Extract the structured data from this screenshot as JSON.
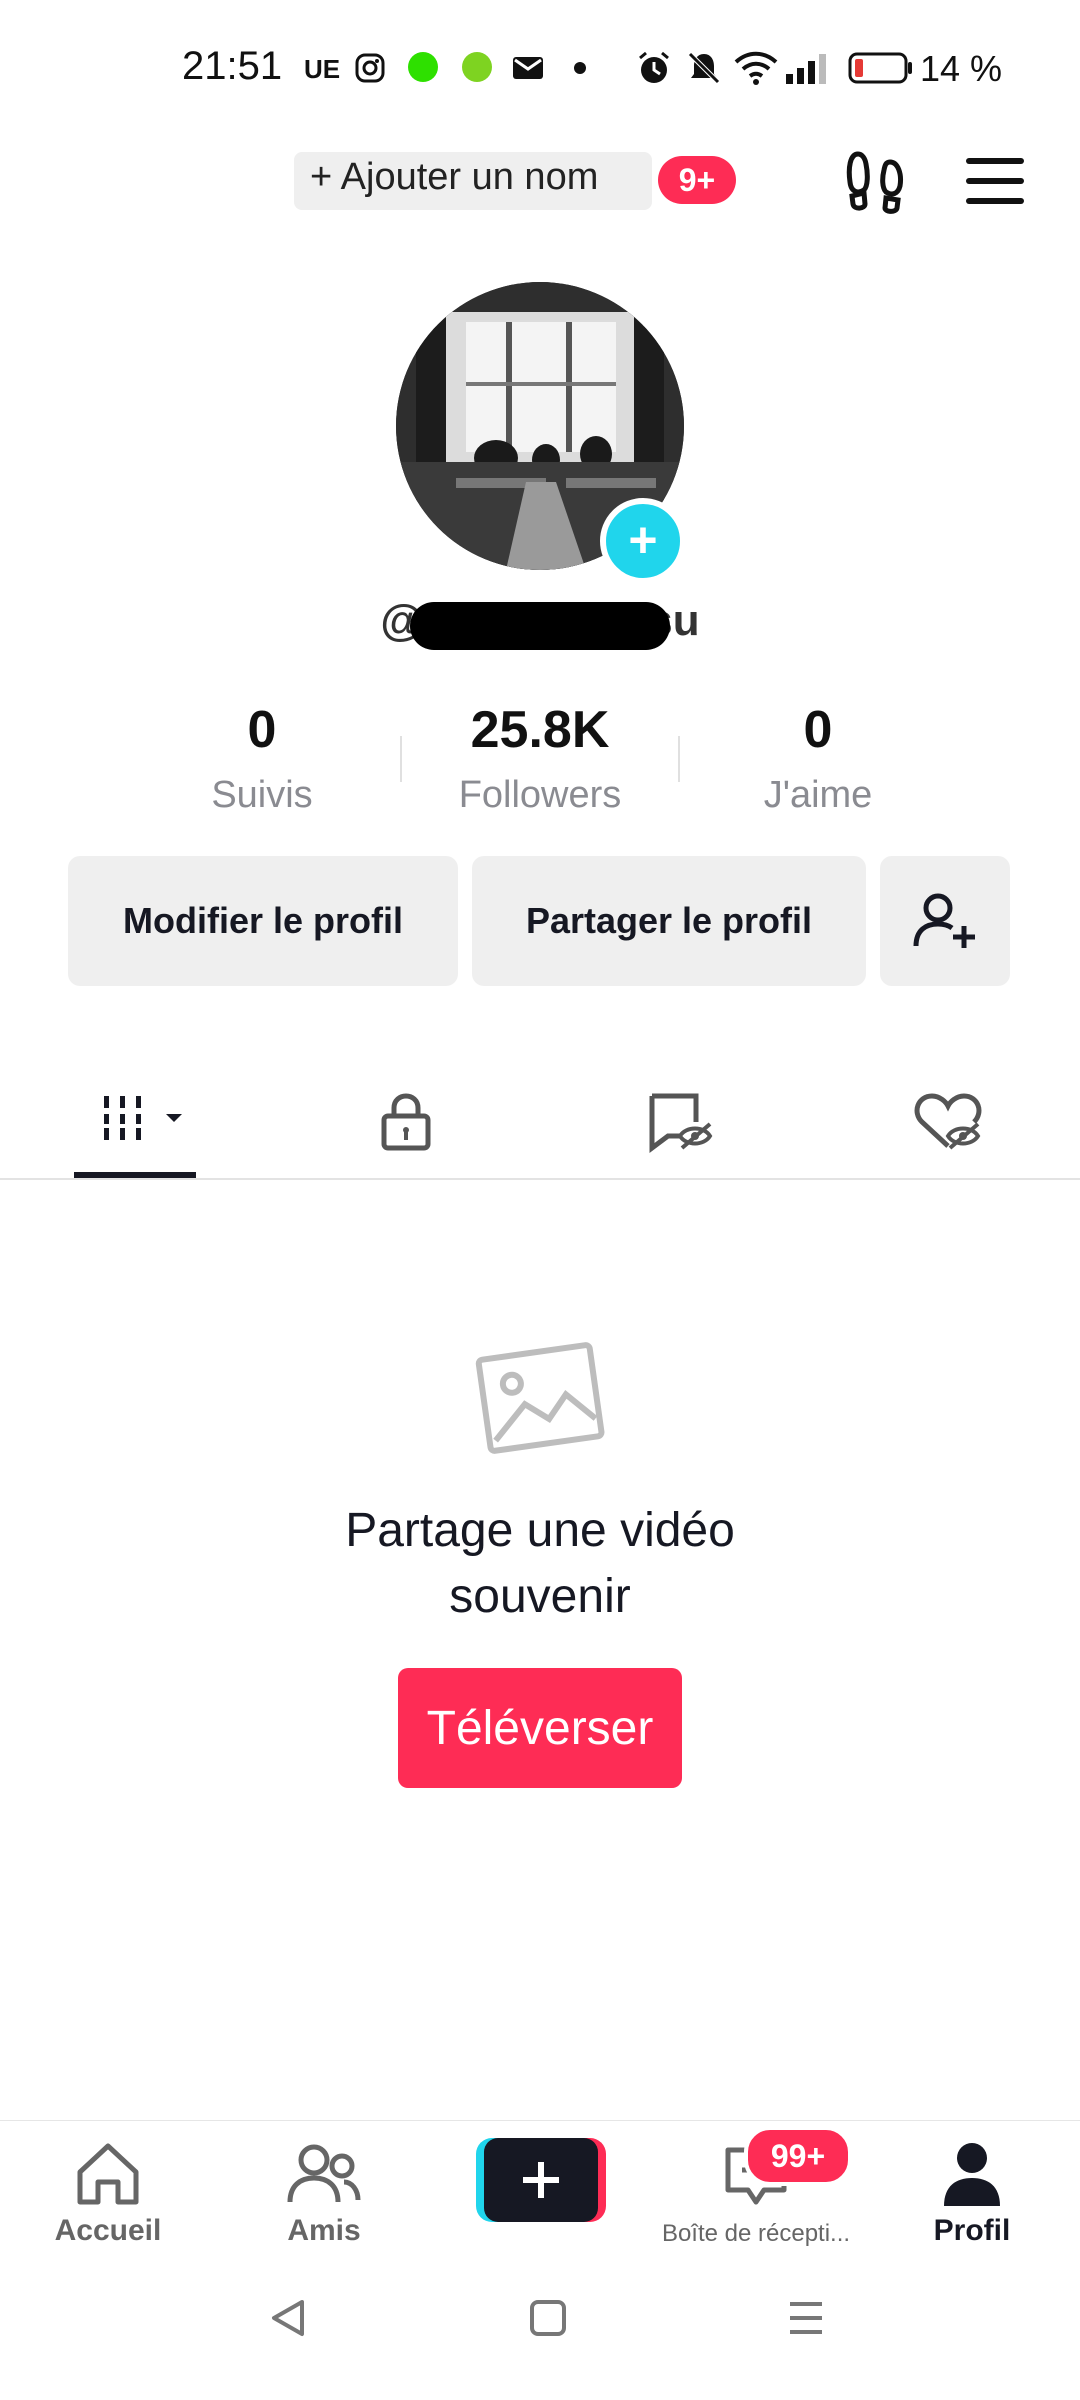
{
  "status_bar": {
    "time": "21:51",
    "carrier_label": "UE",
    "battery_percent": "14 %",
    "battery_level": 0.14,
    "icons": [
      "instagram-icon",
      "green-dot",
      "green-dot",
      "mail-icon",
      "dot",
      "alarm-icon",
      "mute-icon",
      "wifi-icon",
      "signal-icon",
      "battery-icon"
    ],
    "colors": {
      "dot1": "#2ee000",
      "dot2": "#7ed321",
      "battery_low": "#e53935"
    }
  },
  "header": {
    "add_name_label": "+ Ajouter un nom",
    "add_name_badge": "9+",
    "footprints_icon": "footprints-icon",
    "menu_icon": "hamburger-icon"
  },
  "profile": {
    "username": "@d              nsu",
    "stats": [
      {
        "value": "0",
        "label": "Suivis"
      },
      {
        "value": "25.8K",
        "label": "Followers"
      },
      {
        "value": "0",
        "label": "J'aime"
      }
    ],
    "buttons": {
      "edit": "Modifier le profil",
      "share": "Partager le profil"
    }
  },
  "tabs": [
    "videos-grid-icon",
    "lock-icon",
    "hidden-reposts-icon",
    "hidden-likes-icon"
  ],
  "empty_state": {
    "title_line1": "Partage une vidéo",
    "title_line2": "souvenir",
    "upload_label": "Téléverser"
  },
  "bottom_nav": {
    "items": [
      {
        "label": "Accueil"
      },
      {
        "label": "Amis"
      },
      {
        "label": ""
      },
      {
        "label": "Boîte de récepti..."
      },
      {
        "label": "Profil"
      }
    ],
    "inbox_badge": "99+"
  },
  "colors": {
    "accent": "#fe2c55",
    "cyan": "#20d5ec",
    "text": "#161823",
    "muted": "#8a8b91"
  }
}
